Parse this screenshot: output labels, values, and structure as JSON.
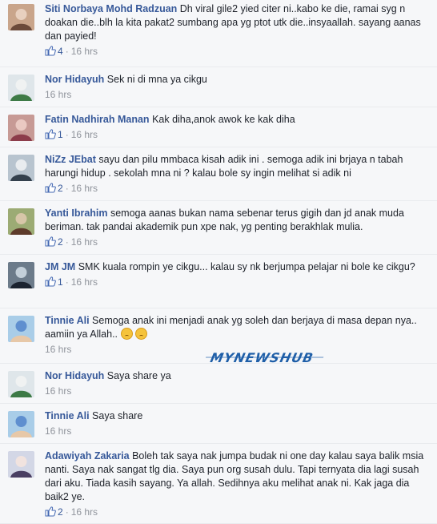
{
  "comments": [
    {
      "author": "Siti Norbaya Mohd Radzuan",
      "text": "Dh viral gile2 yied citer ni..kabo ke die, ramai syg n doakan die..blh la kita pakat2 sumbang apa yg ptot utk die..insyaallah. sayang aanas dan payied!",
      "likes": "4",
      "time": "16 hrs",
      "avatar": "avatar-siti"
    },
    {
      "author": "Nor Hidayuh",
      "text": "Sek ni di mna ya cikgu",
      "likes": "",
      "time": "16 hrs",
      "avatar": "avatar-nor"
    },
    {
      "author": "Fatin Nadhirah Manan",
      "text": "Kak diha,anok awok ke kak diha",
      "likes": "1",
      "time": "16 hrs",
      "avatar": "avatar-fatin"
    },
    {
      "author": "NiZz JEbat",
      "text": "sayu dan pilu mmbaca kisah adik ini . semoga adik ini brjaya n tabah harungi hidup . sekolah mna ni ? kalau bole sy ingin melihat si adik ni",
      "likes": "2",
      "time": "16 hrs",
      "avatar": "avatar-nizz"
    },
    {
      "author": "Yanti Ibrahim",
      "text": "semoga aanas bukan nama sebenar terus gigih dan jd anak muda beriman. tak pandai akademik pun xpe nak, yg penting berakhlak mulia.",
      "likes": "2",
      "time": "16 hrs",
      "avatar": "avatar-yanti"
    },
    {
      "author": "JM JM",
      "text": "SMK kuala rompin ye cikgu... kalau sy nk berjumpa pelajar ni bole ke cikgu?",
      "likes": "1",
      "time": "16 hrs",
      "avatar": "avatar-jm"
    },
    {
      "author": "Tinnie Ali",
      "text": "Semoga anak ini menjadi anak yg soleh dan berjaya di masa depan nya.. aamiin ya Allah..",
      "likes": "",
      "time": "16 hrs",
      "avatar": "avatar-tinnie",
      "emoji_count": 2
    },
    {
      "author": "Nor Hidayuh",
      "text": "Saya share ya",
      "likes": "",
      "time": "16 hrs",
      "avatar": "avatar-nor"
    },
    {
      "author": "Tinnie Ali",
      "text": "Saya share",
      "likes": "",
      "time": "16 hrs",
      "avatar": "avatar-tinnie"
    },
    {
      "author": "Adawiyah Zakaria",
      "text": "Boleh tak saya nak jumpa budak ni one day kalau saya balik msia nanti. Saya nak sangat tlg dia. Saya pun org susah dulu. Tapi ternyata dia lagi susah dari aku. Tiada kasih sayang. Ya allah. Sedihnya aku melihat anak ni. Kak jaga dia baik2 ye.",
      "likes": "2",
      "time": "16 hrs",
      "avatar": "avatar-adawiyah"
    }
  ],
  "watermark": "MYNEWSHUB",
  "colors": {
    "author": "#365899",
    "meta": "#90949c",
    "background": "#f6f7f9"
  }
}
